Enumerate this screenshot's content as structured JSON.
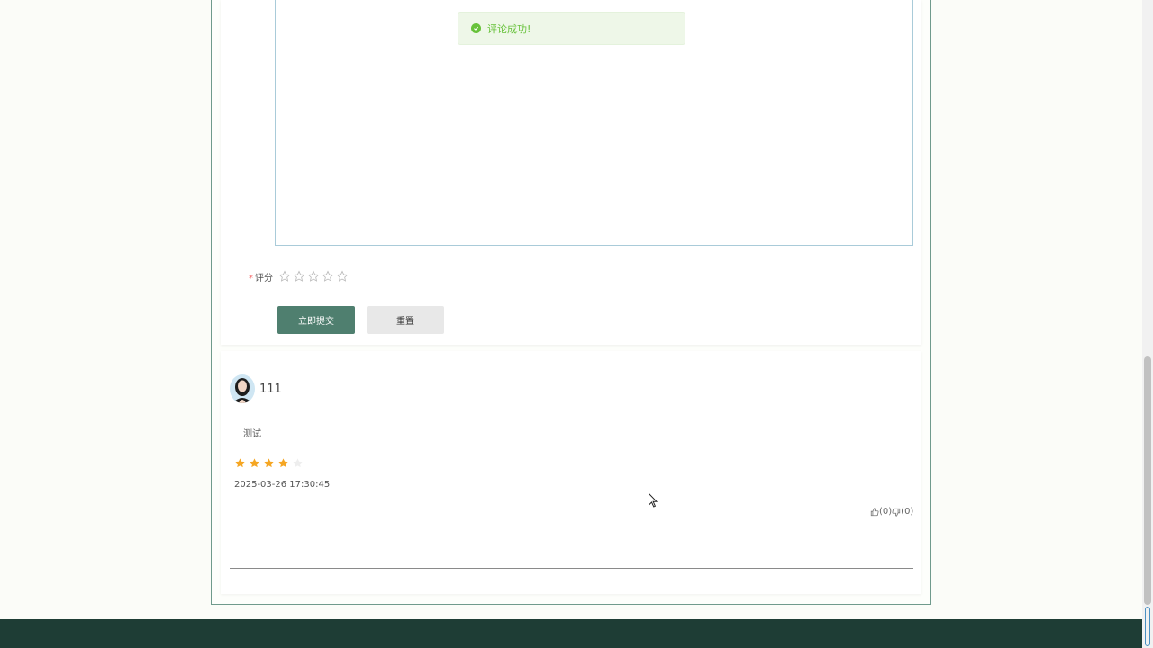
{
  "toast": {
    "message": "评论成功!",
    "icon": "check-circle-icon",
    "color": "#67c23a"
  },
  "form": {
    "rating_label": "评分",
    "required_mark": "*",
    "rating_value": 0,
    "rating_max": 5,
    "submit_label": "立即提交",
    "reset_label": "重置"
  },
  "comment": {
    "username": "111",
    "text": "测试",
    "rating": 4,
    "rating_max": 5,
    "timestamp": "2025-03-26 17:30:45",
    "likes": "(0)",
    "dislikes": "(0)"
  },
  "colors": {
    "accent": "#4f7f6f",
    "star_filled": "#f5a623",
    "footer": "#1e3d35"
  }
}
